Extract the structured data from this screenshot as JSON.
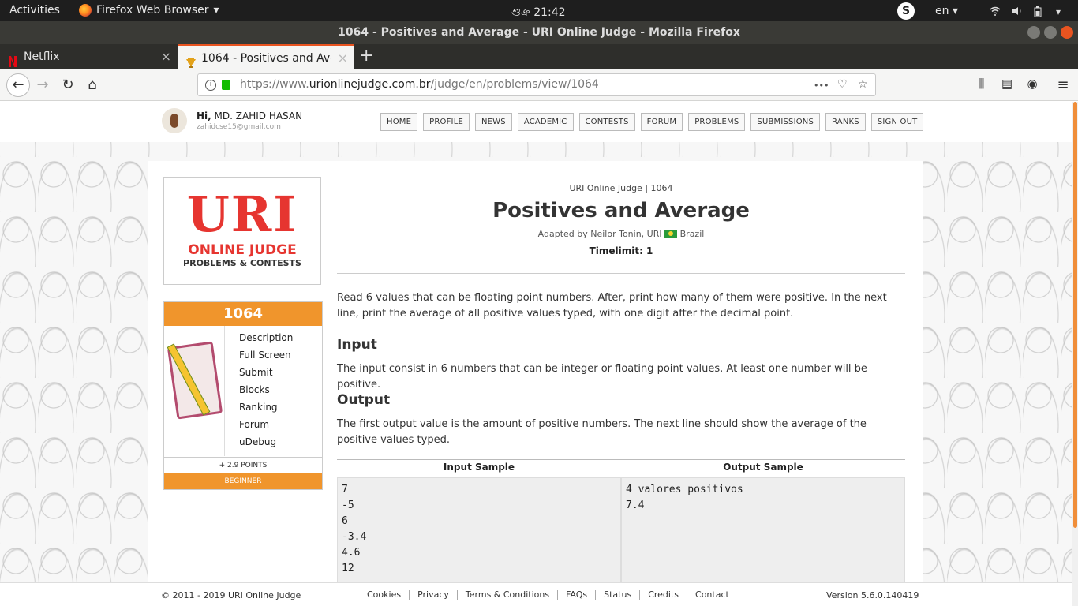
{
  "topbar": {
    "activities": "Activities",
    "app_name": "Firefox Web Browser",
    "app_arrow": "▾",
    "clock": "শুক্র 21:42",
    "skype_label": "S",
    "lang": "en",
    "lang_arrow": "▾"
  },
  "window": {
    "title": "1064 - Positives and Average - URI Online Judge - Mozilla Firefox"
  },
  "tabs": [
    {
      "title": "Netflix",
      "close": "×"
    },
    {
      "title": "1064 - Positives and Average - URI Online Judge",
      "close": "×"
    }
  ],
  "newtab": "+",
  "nav": {
    "back": "←",
    "forward": "→",
    "reload": "↻",
    "home": "⌂",
    "url_prefix": "https://www.",
    "url_domain": "urionlinejudge.com.br",
    "url_path": "/judge/en/problems/view/1064",
    "more": "•••",
    "pocket": "♡",
    "star": "☆",
    "library": "⫼",
    "sidebar": "▤",
    "account": "◉",
    "menu": "≡"
  },
  "site": {
    "greeting_hi": "Hi,",
    "user_name": "MD. ZAHID HASAN",
    "user_email": "zahidcse15@gmail.com",
    "menu": [
      "HOME",
      "PROFILE",
      "NEWS",
      "ACADEMIC",
      "CONTESTS",
      "FORUM",
      "PROBLEMS",
      "SUBMISSIONS",
      "RANKS",
      "SIGN OUT"
    ]
  },
  "logo": {
    "big": "URI",
    "line1": "ONLINE JUDGE",
    "line2": "PROBLEMS & CONTESTS"
  },
  "problem_box": {
    "number": "1064",
    "links": [
      "Description",
      "Full Screen",
      "Submit",
      "Blocks",
      "Ranking",
      "Forum",
      "uDebug"
    ],
    "points": "+ 2.9 POINTS",
    "level": "BEGINNER"
  },
  "problem": {
    "crumb": "URI Online Judge | 1064",
    "title": "Positives and Average",
    "adapted_by": "Adapted by Neilor Tonin, URI",
    "country": "Brazil",
    "timelimit": "Timelimit: 1",
    "description": "Read 6 values that can be floating point numbers. After, print how many of them were positive. In the next line, print the average of all positive values typed, with one digit after the decimal point.",
    "input_title": "Input",
    "input_text": "The input consist in 6 numbers that can be integer or floating point values. At least one number will be positive.",
    "output_title": "Output",
    "output_text": "The first output value is the amount of positive numbers. The next line should show the average of the positive values typed.",
    "input_sample_title": "Input Sample",
    "output_sample_title": "Output Sample",
    "input_sample": "7\n-5\n6\n-3.4\n4.6\n12",
    "output_sample": "4 valores positivos\n7.4"
  },
  "footer": {
    "copyright": "© 2011 - 2019 URI Online Judge",
    "links": [
      "Cookies",
      "Privacy",
      "Terms & Conditions",
      "FAQs",
      "Status",
      "Credits",
      "Contact"
    ],
    "version": "Version 5.6.0.140419"
  },
  "colors": {
    "accent": "#f0952c",
    "logo_red": "#e63530",
    "ubuntu_orange": "#e95420"
  }
}
